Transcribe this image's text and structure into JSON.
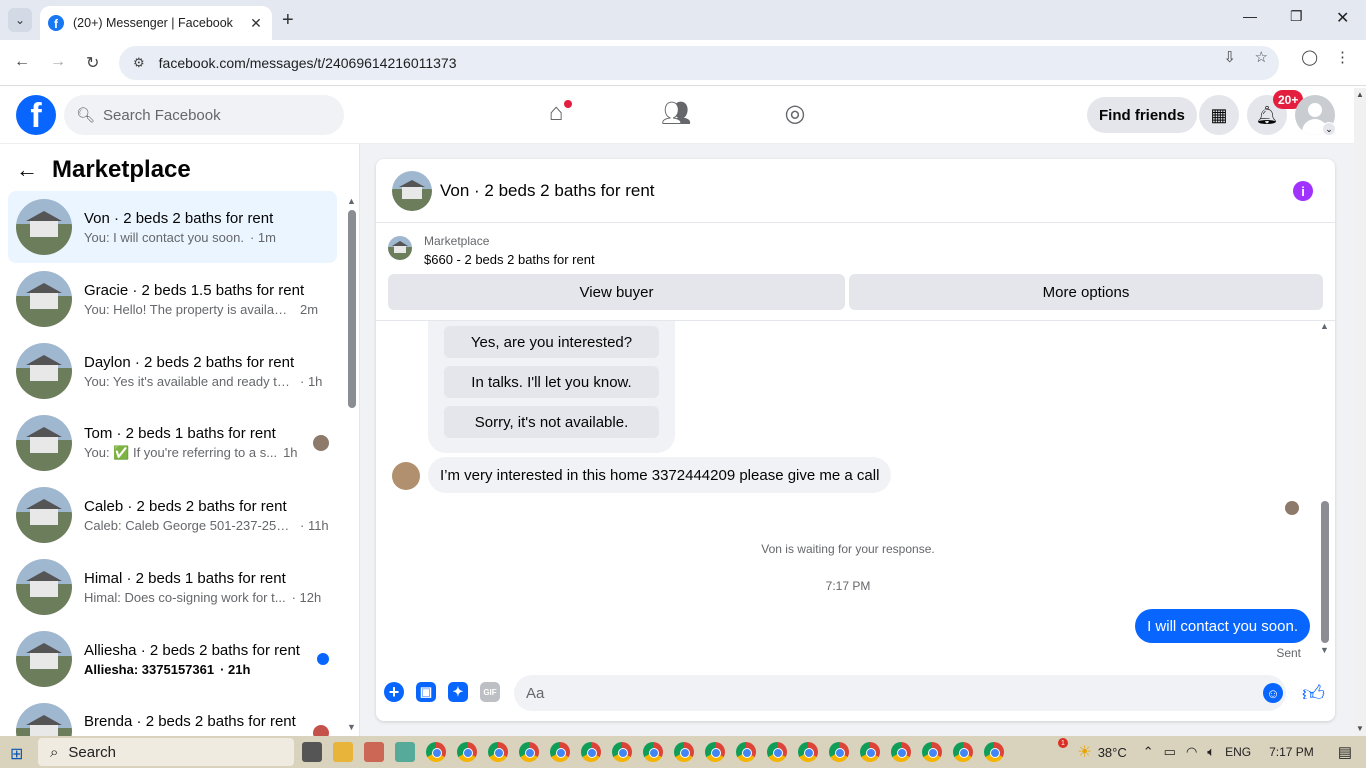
{
  "browser": {
    "tab_title": "(20+) Messenger | Facebook",
    "url": "facebook.com/messages/t/24069614216011373",
    "favicon": "f"
  },
  "fb": {
    "logo": "f",
    "search_placeholder": "Search Facebook",
    "find_friends": "Find friends",
    "notif_badge": "20+"
  },
  "left": {
    "title": "Marketplace",
    "conversations": [
      {
        "name": "Von · 2 beds 2 baths for rent",
        "preview": "You: I will contact you soon.",
        "time": "· 1m",
        "active": true
      },
      {
        "name": "Gracie · 2 beds 1.5 baths for rent",
        "preview": "You: Hello! The property is availabl...",
        "time": "2m"
      },
      {
        "name": "Daylon · 2 beds 2 baths for rent",
        "preview": "You: Yes it's available and ready to ...",
        "time": "· 1h"
      },
      {
        "name": "Tom · 2 beds 1 baths for rent",
        "preview": "You: ✅ If you're referring to a s...",
        "time": "1h"
      },
      {
        "name": "Caleb · 2 beds 2 baths for rent",
        "preview": "Caleb: Caleb George 501-237-255...",
        "time": "· 11h"
      },
      {
        "name": "Himal · 2 beds 1 baths for rent",
        "preview": "Himal: Does co-signing work for t...",
        "time": "· 12h"
      },
      {
        "name": "Alliesha · 2 beds 2 baths for rent",
        "preview": "Alliesha: 3375157361",
        "time": "· 21h",
        "unread": true
      },
      {
        "name": "Brenda · 2 beds 2 baths for rent",
        "preview": "",
        "time": ""
      }
    ]
  },
  "chat": {
    "title": "Von · 2 beds 2 baths for rent",
    "listing_kind": "Marketplace",
    "listing_price": "$660 - 2 beds 2 baths for rent",
    "view_buyer": "View buyer",
    "more_options": "More options",
    "quick_replies": [
      "Yes, are you interested?",
      "In talks. I'll let you know.",
      "Sorry, it's not available."
    ],
    "incoming": "I’m very interested in this home 3372444209 please give me a call",
    "waiting": "Von is waiting for your response.",
    "timestamp": "7:17 PM",
    "outgoing": "I will contact you soon.",
    "status": "Sent",
    "input_placeholder": "Aa",
    "gif": "GIF"
  },
  "taskbar": {
    "search": "Search",
    "temperature": "38°C",
    "lang": "ENG",
    "clock": "7:17 PM"
  },
  "colors": {
    "fb_blue": "#0866ff",
    "active_conv": "#ebf5ff",
    "badge_red": "#e41e3f"
  }
}
